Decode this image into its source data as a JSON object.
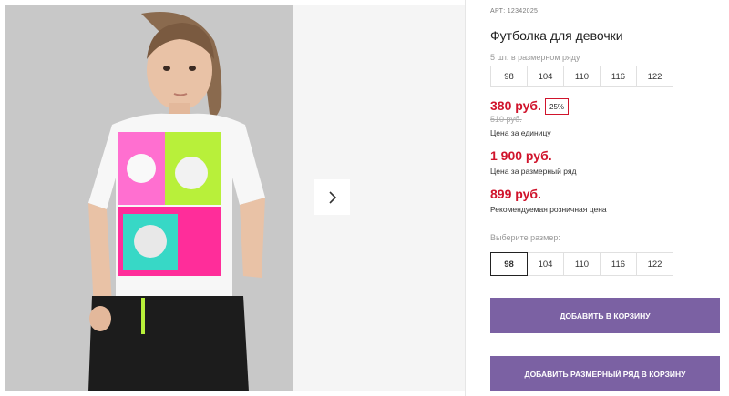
{
  "product": {
    "art_label": "АРТ:",
    "art_number": "12342025",
    "title": "Футболка для девочки"
  },
  "pack": {
    "label": "5 шт. в размерном ряду",
    "sizes": [
      "98",
      "104",
      "110",
      "116",
      "122"
    ]
  },
  "prices": {
    "unit_price": "380 руб.",
    "discount": "25%",
    "old_price": "510 руб.",
    "unit_caption": "Цена за единицу",
    "pack_price": "1 900 руб.",
    "pack_caption": "Цена за размерный ряд",
    "retail_price": "899 руб.",
    "retail_caption": "Рекомендуемая розничная цена",
    "accent_color": "#d0142c"
  },
  "size_select": {
    "label": "Выберите размер:",
    "options": [
      "98",
      "104",
      "110",
      "116",
      "122"
    ],
    "selected": "98"
  },
  "buttons": {
    "add_to_cart": "ДОБАВИТЬ В КОРЗИНУ",
    "add_pack_to_cart": "ДОБАВИТЬ РАЗМЕРНЫЙ РЯД В КОРЗИНУ",
    "color": "#7b61a3"
  },
  "gallery": {
    "next_icon": "chevron-right-icon"
  }
}
